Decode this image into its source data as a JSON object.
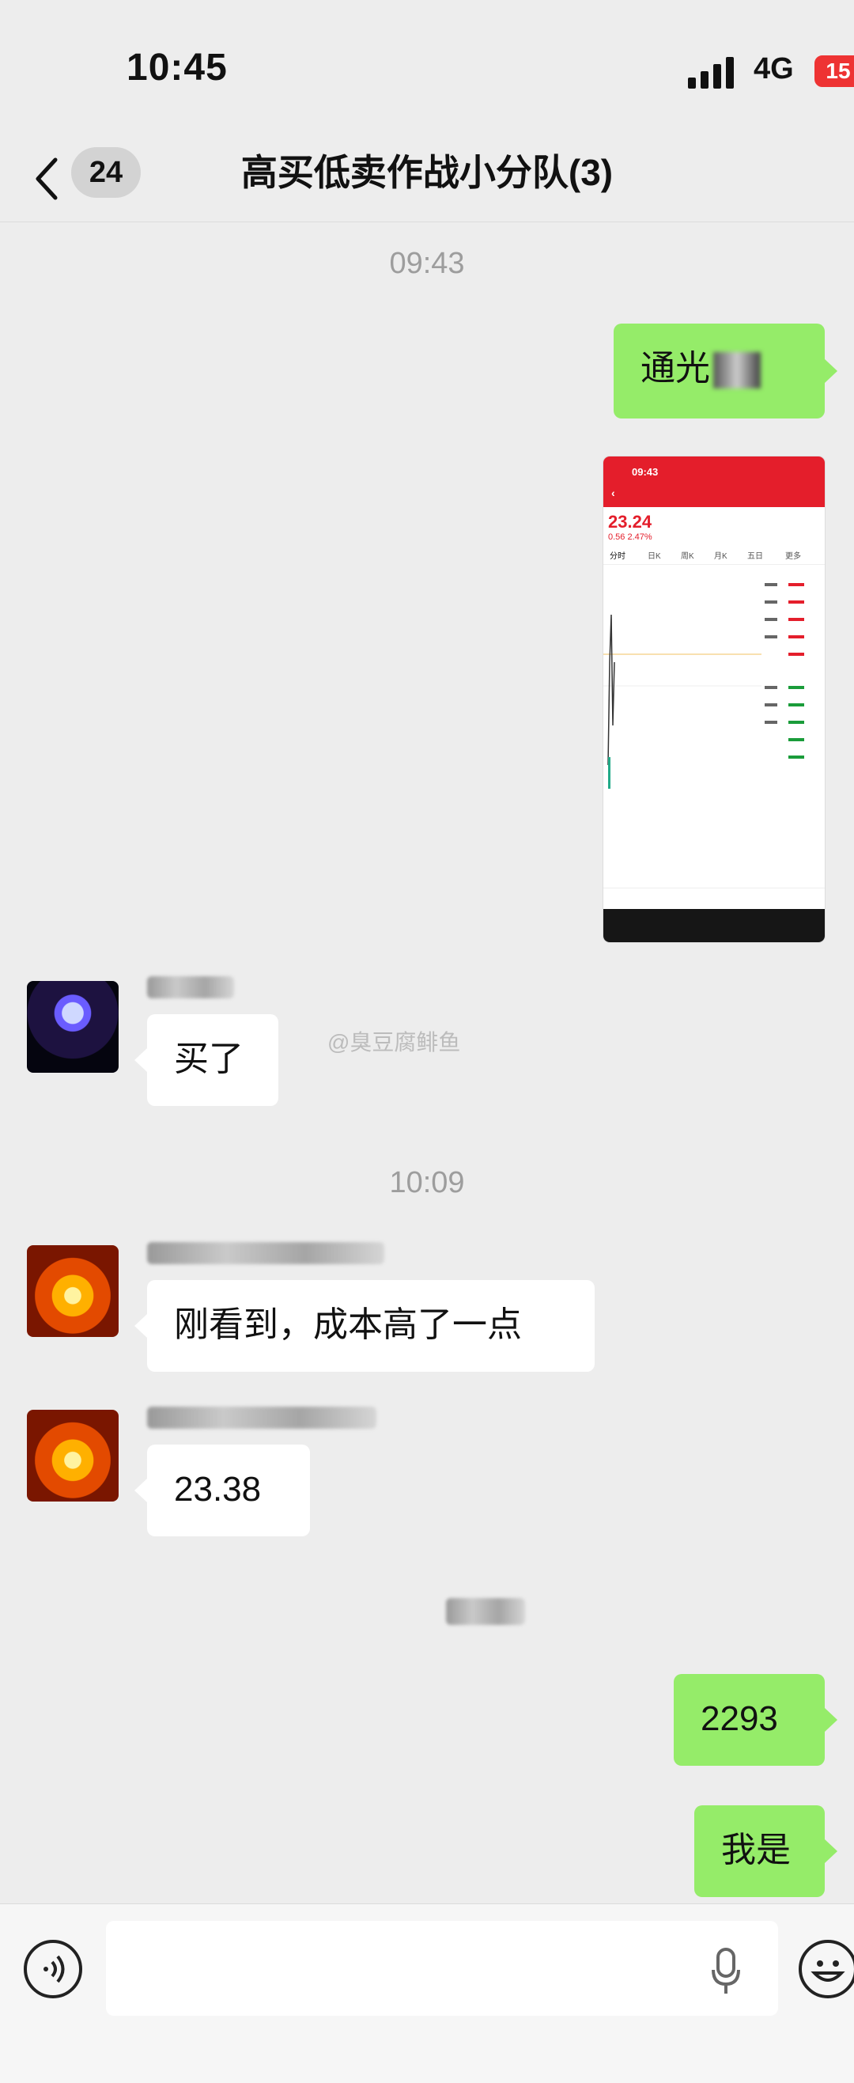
{
  "status_bar": {
    "time": "10:45",
    "network": "4G",
    "battery": "15"
  },
  "nav": {
    "back_badge": "24",
    "title": "高买低卖作战小分队(3)"
  },
  "stamps": {
    "first": "09:43",
    "second": "10:09"
  },
  "messages": {
    "m1": "通光",
    "m2": "买了",
    "m3": "刚看到，成本高了一点",
    "m4": "23.38",
    "m5": "2293",
    "m6": "我是"
  },
  "screenshot": {
    "time": "09:43",
    "price": "23.24",
    "change": "0.56  2.47%",
    "tabs": [
      "分时",
      "日K",
      "周K",
      "月K",
      "五日",
      "更多"
    ]
  },
  "watermark": "@臭豆腐鲱鱼",
  "colors": {
    "me_bubble": "#95ec69",
    "other_bubble": "#ffffff",
    "background": "#ededed"
  }
}
